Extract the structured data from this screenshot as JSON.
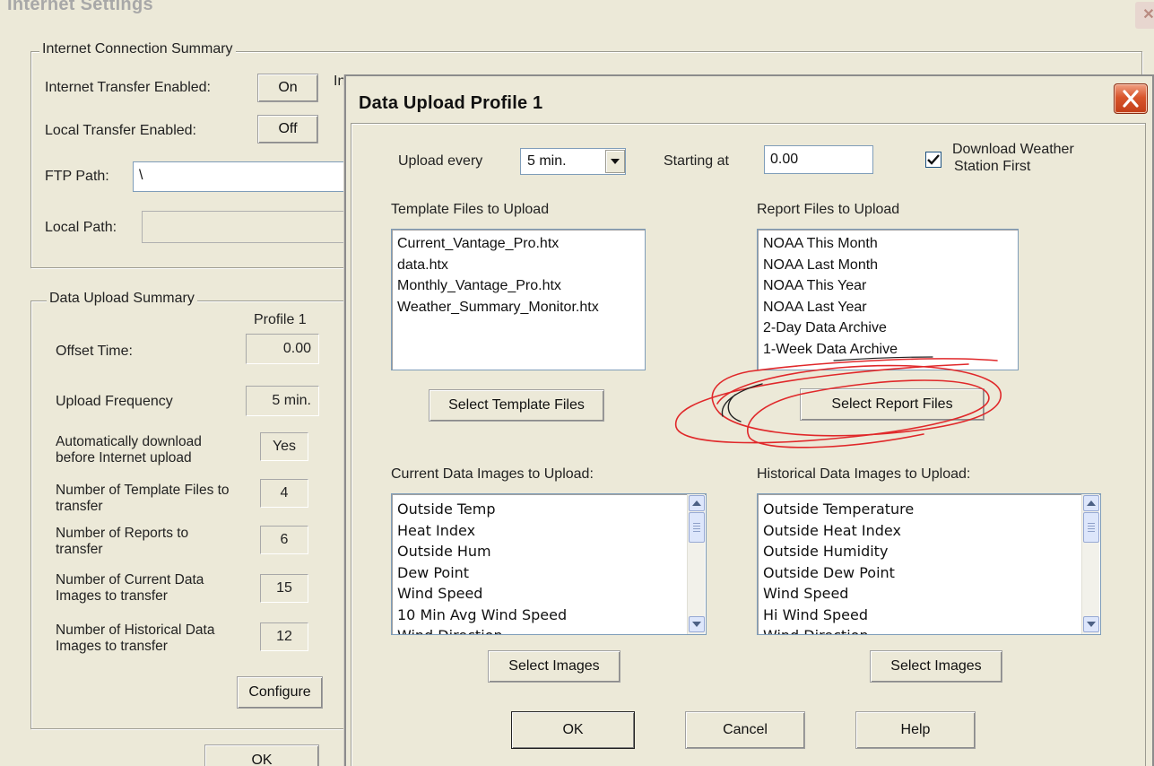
{
  "background_window": {
    "title": "Internet Settings",
    "connection_summary": {
      "legend": "Internet Connection Summary",
      "internet_transfer_label": "Internet Transfer Enabled:",
      "internet_transfer_value": "On",
      "local_transfer_label": "Local Transfer Enabled:",
      "local_transfer_value": "Off",
      "ftp_path_label": "FTP Path:",
      "ftp_path_value": "\\",
      "local_path_label": "Local Path:",
      "local_path_value": "",
      "cut_label": "In"
    },
    "upload_summary": {
      "legend": "Data Upload Summary",
      "profile_header": "Profile 1",
      "rows": [
        {
          "label": "Offset Time:",
          "value": "0.00"
        },
        {
          "label": "Upload Frequency",
          "value": "5 min."
        },
        {
          "label": "Automatically download before Internet upload",
          "value": "Yes"
        },
        {
          "label": "Number of Template Files to transfer",
          "value": "4"
        },
        {
          "label": "Number of Reports to transfer",
          "value": "6"
        },
        {
          "label": "Number of Current Data Images to transfer",
          "value": "15"
        },
        {
          "label": "Number of Historical Data Images to transfer",
          "value": "12"
        }
      ],
      "configure_label": "Configure"
    },
    "ok_label": "OK"
  },
  "dialog": {
    "title": "Data Upload Profile 1",
    "upload_every_label": "Upload every",
    "upload_every_value": "5 min.",
    "starting_at_label": "Starting at",
    "starting_at_value": "0.00",
    "download_checkbox_label_line1": "Download Weather",
    "download_checkbox_label_line2": "Station First",
    "download_checked": true,
    "template_files_label": "Template Files to Upload",
    "template_files": [
      "Current_Vantage_Pro.htx",
      "data.htx",
      "Monthly_Vantage_Pro.htx",
      "Weather_Summary_Monitor.htx"
    ],
    "select_template_label": "Select Template Files",
    "report_files_label": "Report Files to Upload",
    "report_files": [
      "NOAA This Month",
      "NOAA Last Month",
      "NOAA This Year",
      "NOAA Last Year",
      "2-Day Data Archive",
      "1-Week Data Archive"
    ],
    "select_report_label": "Select Report Files",
    "current_images_label": "Current Data Images to Upload:",
    "current_images": [
      "Outside Temp",
      "Heat Index",
      "Outside Hum",
      "Dew Point",
      "Wind Speed",
      "10 Min Avg Wind Speed",
      "Wind Direction"
    ],
    "historical_images_label": "Historical Data Images to Upload:",
    "historical_images": [
      "Outside Temperature",
      "Outside Heat Index",
      "Outside Humidity",
      "Outside Dew Point",
      "Wind Speed",
      "Hi Wind Speed",
      "Wind Direction"
    ],
    "select_images_label": "Select Images",
    "ok_label": "OK",
    "cancel_label": "Cancel",
    "help_label": "Help"
  },
  "colors": {
    "annotation_red": "#e0282a",
    "window_bg": "#ece9d8",
    "close_button": "#d8552c"
  }
}
